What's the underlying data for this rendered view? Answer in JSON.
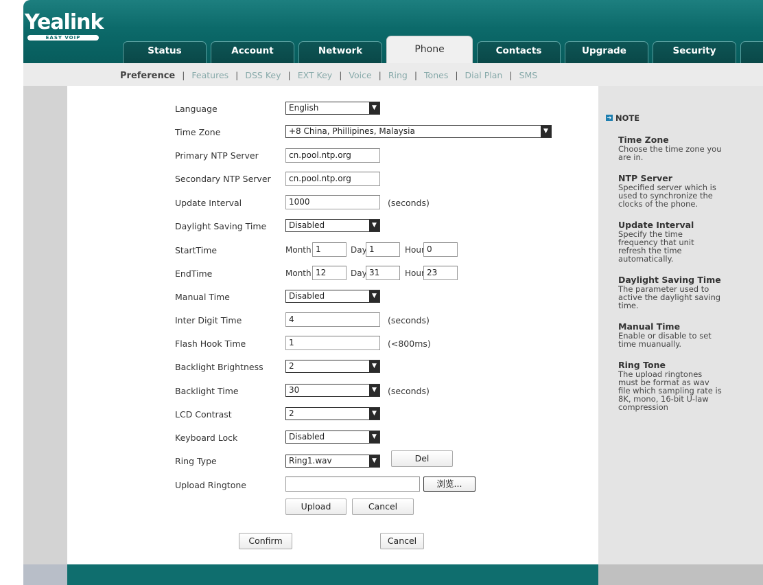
{
  "logo": {
    "brand": "Yealink",
    "slogan": "EASY VOIP"
  },
  "tabs": [
    {
      "label": "Status"
    },
    {
      "label": "Account"
    },
    {
      "label": "Network"
    },
    {
      "label": "Phone"
    },
    {
      "label": "Contacts"
    },
    {
      "label": "Upgrade"
    },
    {
      "label": "Security"
    }
  ],
  "active_tab": "Phone",
  "subnav": [
    {
      "label": "Preference"
    },
    {
      "label": "Features"
    },
    {
      "label": "DSS Key"
    },
    {
      "label": "EXT Key"
    },
    {
      "label": "Voice"
    },
    {
      "label": "Ring"
    },
    {
      "label": "Tones"
    },
    {
      "label": "Dial Plan"
    },
    {
      "label": "SMS"
    }
  ],
  "separator": "|",
  "form": {
    "language": {
      "label": "Language",
      "value": "English"
    },
    "time_zone": {
      "label": "Time Zone",
      "value": "+8  China, Phillipines, Malaysia"
    },
    "primary_ntp": {
      "label": "Primary NTP Server",
      "value": "cn.pool.ntp.org"
    },
    "secondary_ntp": {
      "label": "Secondary NTP Server",
      "value": "cn.pool.ntp.org"
    },
    "update_interval": {
      "label": "Update Interval",
      "value": "1000",
      "unit": "(seconds)"
    },
    "dst": {
      "label": "Daylight Saving Time",
      "value": "Disabled"
    },
    "start_time": {
      "label": "StartTime",
      "month_label": "Month",
      "month": "1",
      "day_label": "Day",
      "day": "1",
      "hour_label": "Hour",
      "hour": "0"
    },
    "end_time": {
      "label": "EndTime",
      "month_label": "Month",
      "month": "12",
      "day_label": "Day",
      "day": "31",
      "hour_label": "Hour",
      "hour": "23"
    },
    "manual_time": {
      "label": "Manual Time",
      "value": "Disabled"
    },
    "inter_digit": {
      "label": "Inter Digit Time",
      "value": "4",
      "unit": "(seconds)"
    },
    "flash_hook": {
      "label": "Flash Hook Time",
      "value": "1",
      "unit": "(<800ms)"
    },
    "backlight_brightness": {
      "label": "Backlight Brightness",
      "value": "2"
    },
    "backlight_time": {
      "label": "Backlight Time",
      "value": "30",
      "unit": "(seconds)"
    },
    "lcd_contrast": {
      "label": "LCD Contrast",
      "value": "2"
    },
    "keyboard_lock": {
      "label": "Keyboard Lock",
      "value": "Disabled"
    },
    "ring_type": {
      "label": "Ring Type",
      "value": "Ring1.wav",
      "del_label": "Del"
    },
    "upload_ringtone": {
      "label": "Upload Ringtone",
      "value": "",
      "browse_label": "浏览...",
      "upload_label": "Upload",
      "cancel_label": "Cancel"
    },
    "confirm_label": "Confirm",
    "cancel_label": "Cancel"
  },
  "note": {
    "header": "NOTE",
    "sections": [
      {
        "title": "Time Zone",
        "text": "Choose the time zone you are in."
      },
      {
        "title": "NTP Server",
        "text": "Specified server which is used to synchronize the clocks of the phone."
      },
      {
        "title": "Update Interval",
        "text": "Specify the time frequency that unit refresh the time automatically."
      },
      {
        "title": "Daylight Saving Time",
        "text": "The parameter used to active the daylight saving time."
      },
      {
        "title": "Manual Time",
        "text": "Enable or disable to set time muanually."
      },
      {
        "title": "Ring Tone",
        "text": "The upload ringtones must be format as wav file which sampling rate is 8K, mono, 16-bit U-law compression"
      }
    ]
  },
  "colors": {
    "header": "#0c6a6a",
    "footer": "#0f6e6e",
    "note_bg": "#e4e4e4",
    "side_bg": "#d3d3d3"
  }
}
